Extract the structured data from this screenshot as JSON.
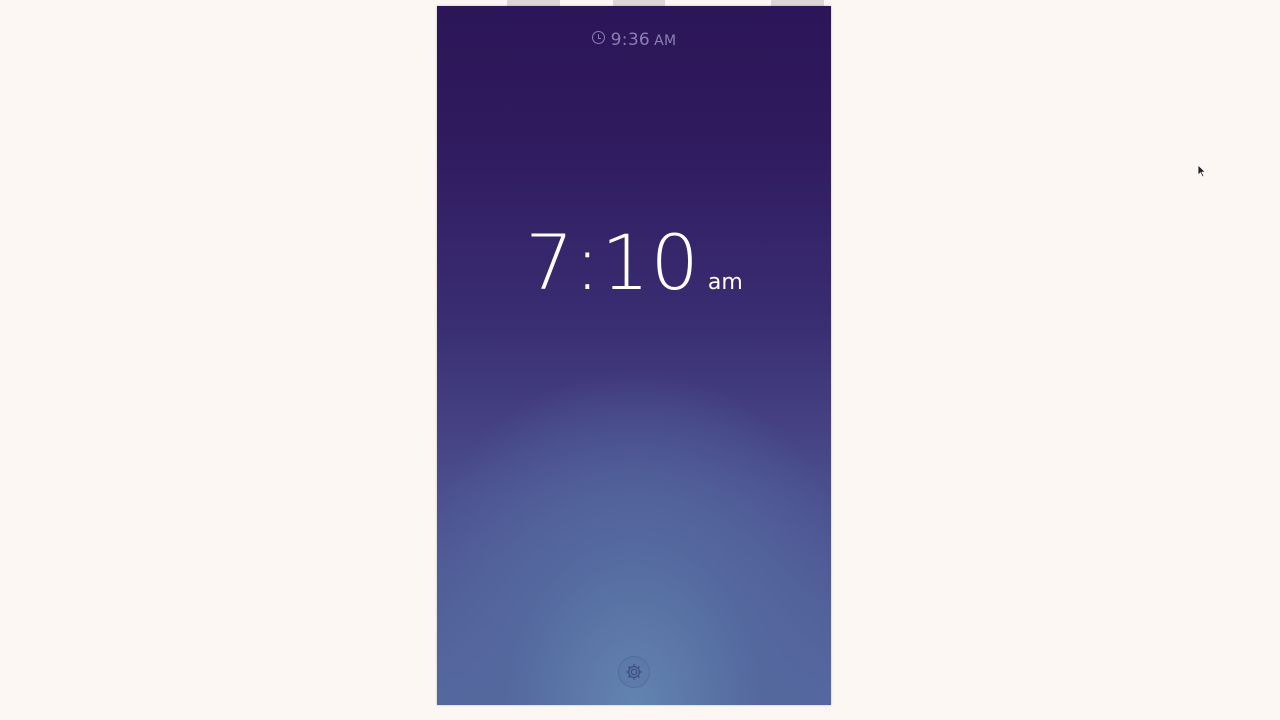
{
  "status_bar": {
    "time": "9:36",
    "meridiem": "AM",
    "icon": "clock-icon"
  },
  "alarm": {
    "time": "7:10",
    "meridiem": "am"
  },
  "footer": {
    "settings_icon": "gear-icon"
  },
  "colors": {
    "background": "#fdf7f3",
    "gradient_top": "#2c1658",
    "gradient_bottom": "#6284b0",
    "status_text": "#8a7fb2",
    "alarm_text": "#ffffff"
  }
}
